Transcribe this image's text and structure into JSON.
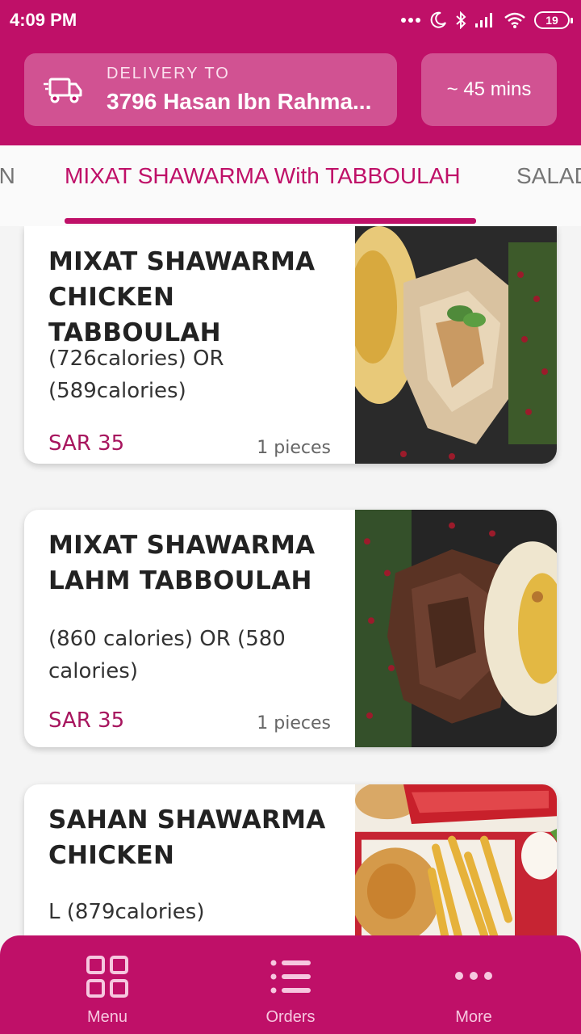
{
  "status_bar": {
    "time": "4:09 PM",
    "battery": "19",
    "icons": [
      "dots-icon",
      "moon-icon",
      "bluetooth-icon",
      "signal-icon",
      "wifi-icon",
      "battery-icon"
    ]
  },
  "header": {
    "delivery_label": "DELIVERY TO",
    "delivery_address": "3796 Hasan Ibn Rahma...",
    "eta": "~ 45 mins",
    "delivery_icon": "truck-icon"
  },
  "tabs": {
    "items": [
      {
        "label": "EN",
        "active": false
      },
      {
        "label": "MIXAT SHAWARMA With TABBOULAH",
        "active": true
      },
      {
        "label": "SALAD",
        "active": false
      }
    ]
  },
  "items": [
    {
      "title": "MIXAT SHAWARMA CHICKEN TABBOULAH",
      "calories": "(726calories) OR (589calories)",
      "price": "SAR 35",
      "pieces": "1 pieces"
    },
    {
      "title": "MIXAT SHAWARMA LAHM TABBOULAH",
      "calories": "(860 calories) OR (580 calories)",
      "price": "SAR 35",
      "pieces": "1 pieces"
    },
    {
      "title": "SAHAN SHAWARMA CHICKEN",
      "calories": "L (879calories)",
      "price": "",
      "pieces": ""
    }
  ],
  "bottom_nav": {
    "items": [
      {
        "label": "Menu",
        "icon": "grid-icon"
      },
      {
        "label": "Orders",
        "icon": "list-icon"
      },
      {
        "label": "More",
        "icon": "more-dots-icon"
      }
    ]
  },
  "colors": {
    "primary": "#bf1068",
    "price": "#a7155e",
    "nav_label": "#f6c7df"
  }
}
